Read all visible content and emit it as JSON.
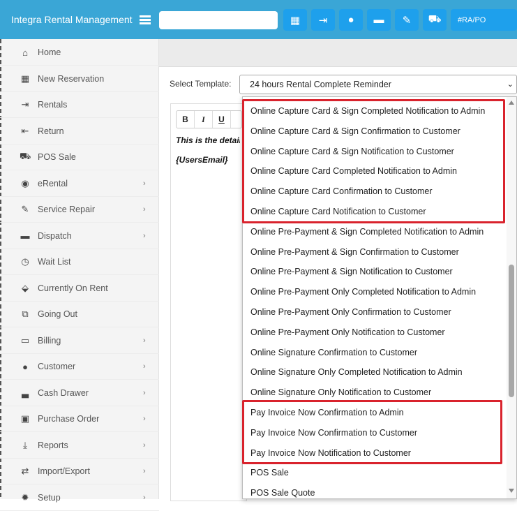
{
  "header": {
    "brand": "Integra Rental Management",
    "search_value": "",
    "quick_link_text": "#RA/PO",
    "icons": [
      "calendar-icon",
      "sign-in-icon",
      "user-icon",
      "truck-icon",
      "wrench-icon",
      "cart-icon"
    ]
  },
  "sidebar": {
    "items": [
      {
        "label": "Home",
        "icon": "home-icon",
        "has_children": false
      },
      {
        "label": "New Reservation",
        "icon": "calendar-icon",
        "has_children": false
      },
      {
        "label": "Rentals",
        "icon": "sign-in-icon",
        "has_children": false
      },
      {
        "label": "Return",
        "icon": "sign-out-icon",
        "has_children": false
      },
      {
        "label": "POS Sale",
        "icon": "cart-icon",
        "has_children": false
      },
      {
        "label": "eRental",
        "icon": "globe-icon",
        "has_children": true
      },
      {
        "label": "Service Repair",
        "icon": "wrench-icon",
        "has_children": true
      },
      {
        "label": "Dispatch",
        "icon": "truck-icon",
        "has_children": true
      },
      {
        "label": "Wait List",
        "icon": "clock-icon",
        "has_children": false
      },
      {
        "label": "Currently On Rent",
        "icon": "map-marker-icon",
        "has_children": false
      },
      {
        "label": "Going Out",
        "icon": "external-link-icon",
        "has_children": false
      },
      {
        "label": "Billing",
        "icon": "credit-card-icon",
        "has_children": true
      },
      {
        "label": "Customer",
        "icon": "user-icon",
        "has_children": true
      },
      {
        "label": "Cash Drawer",
        "icon": "laptop-icon",
        "has_children": true
      },
      {
        "label": "Purchase Order",
        "icon": "briefcase-icon",
        "has_children": true
      },
      {
        "label": "Reports",
        "icon": "download-icon",
        "has_children": true
      },
      {
        "label": "Import/Export",
        "icon": "exchange-icon",
        "has_children": true
      },
      {
        "label": "Setup",
        "icon": "gear-icon",
        "has_children": true
      }
    ],
    "chevron": "›"
  },
  "template": {
    "label": "Select Template:",
    "selected": "24 hours Rental Complete Reminder",
    "caret": "⌄"
  },
  "editor": {
    "toolbar": [
      "B",
      "I",
      "U"
    ],
    "line1": "This is the details",
    "line2": "{UsersEmail}"
  },
  "dropdown": {
    "options": [
      "Online Capture Card & Sign Completed Notification to Admin",
      "Online Capture Card & Sign Confirmation to Customer",
      "Online Capture Card & Sign Notification to Customer",
      "Online Capture Card Completed Notification to Admin",
      "Online Capture Card Confirmation to Customer",
      "Online Capture Card Notification to Customer",
      "Online Pre-Payment & Sign Completed Notification to Admin",
      "Online Pre-Payment & Sign Confirmation to Customer",
      "Online Pre-Payment & Sign Notification to Customer",
      "Online Pre-Payment Only Completed Notification to Admin",
      "Online Pre-Payment Only Confirmation to Customer",
      "Online Pre-Payment Only Notification to Customer",
      "Online Signature Confirmation to Customer",
      "Online Signature Only Completed Notification to Admin",
      "Online Signature Only Notification to Customer",
      "Pay Invoice Now Confirmation to Admin",
      "Pay Invoice Now Confirmation to Customer",
      "Pay Invoice Now Notification to Customer",
      "POS Sale",
      "POS Sale Quote"
    ],
    "highlight_color": "#d9232d"
  }
}
